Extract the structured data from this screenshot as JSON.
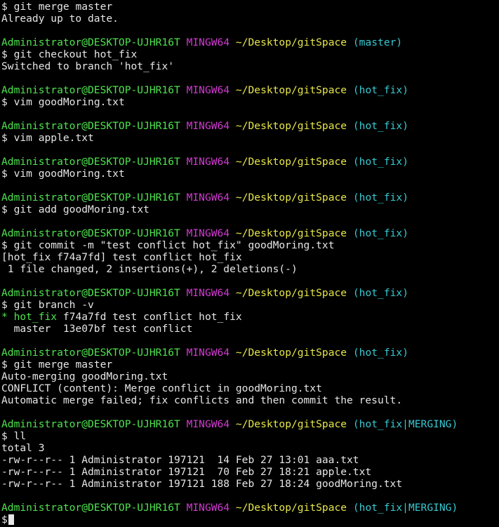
{
  "prompt": {
    "user": "Administrator@DESKTOP-UJHR16T",
    "system": "MINGW64",
    "path": "~/Desktop/gitSpace",
    "dollar": "$"
  },
  "lines": [
    {
      "type": "cmd",
      "text": "git merge master"
    },
    {
      "type": "out",
      "text": "Already up to date."
    },
    {
      "type": "blank"
    },
    {
      "type": "prompt",
      "branch": "master"
    },
    {
      "type": "cmd",
      "text": "git checkout hot_fix"
    },
    {
      "type": "out",
      "text": "Switched to branch 'hot_fix'"
    },
    {
      "type": "blank"
    },
    {
      "type": "prompt",
      "branch": "hot_fix"
    },
    {
      "type": "cmd",
      "text": "vim goodMoring.txt"
    },
    {
      "type": "blank"
    },
    {
      "type": "prompt",
      "branch": "hot_fix"
    },
    {
      "type": "cmd",
      "text": "vim apple.txt"
    },
    {
      "type": "blank"
    },
    {
      "type": "prompt",
      "branch": "hot_fix"
    },
    {
      "type": "cmd",
      "text": "vim goodMoring.txt"
    },
    {
      "type": "blank"
    },
    {
      "type": "prompt",
      "branch": "hot_fix"
    },
    {
      "type": "cmd",
      "text": "git add goodMoring.txt"
    },
    {
      "type": "blank"
    },
    {
      "type": "prompt",
      "branch": "hot_fix"
    },
    {
      "type": "cmd",
      "text": "git commit -m \"test conflict hot_fix\" goodMoring.txt"
    },
    {
      "type": "out",
      "text": "[hot_fix f74a7fd] test conflict hot_fix"
    },
    {
      "type": "out",
      "text": " 1 file changed, 2 insertions(+), 2 deletions(-)"
    },
    {
      "type": "blank"
    },
    {
      "type": "prompt",
      "branch": "hot_fix"
    },
    {
      "type": "cmd",
      "text": "git branch -v"
    },
    {
      "type": "branchline",
      "marker": "* ",
      "name": "hot_fix",
      "rest": " f74a7fd test conflict hot_fix"
    },
    {
      "type": "out",
      "text": "  master  13e07bf test conflict"
    },
    {
      "type": "blank"
    },
    {
      "type": "prompt",
      "branch": "hot_fix"
    },
    {
      "type": "cmd",
      "text": "git merge master"
    },
    {
      "type": "out",
      "text": "Auto-merging goodMoring.txt"
    },
    {
      "type": "out",
      "text": "CONFLICT (content): Merge conflict in goodMoring.txt"
    },
    {
      "type": "out",
      "text": "Automatic merge failed; fix conflicts and then commit the result."
    },
    {
      "type": "blank"
    },
    {
      "type": "prompt",
      "branch": "hot_fix|MERGING"
    },
    {
      "type": "cmd",
      "text": "ll"
    },
    {
      "type": "out",
      "text": "total 3"
    },
    {
      "type": "out",
      "text": "-rw-r--r-- 1 Administrator 197121  14 Feb 27 13:01 aaa.txt"
    },
    {
      "type": "out",
      "text": "-rw-r--r-- 1 Administrator 197121  70 Feb 27 18:21 apple.txt"
    },
    {
      "type": "out",
      "text": "-rw-r--r-- 1 Administrator 197121 188 Feb 27 18:24 goodMoring.txt"
    },
    {
      "type": "blank"
    },
    {
      "type": "prompt",
      "branch": "hot_fix|MERGING"
    },
    {
      "type": "cursorline"
    }
  ],
  "colors": {
    "background": "#000000",
    "text": "#e6e6e6",
    "user": "#4ee34e",
    "system": "#d23ad2",
    "path": "#e6e64a",
    "branch": "#37c9d2"
  }
}
